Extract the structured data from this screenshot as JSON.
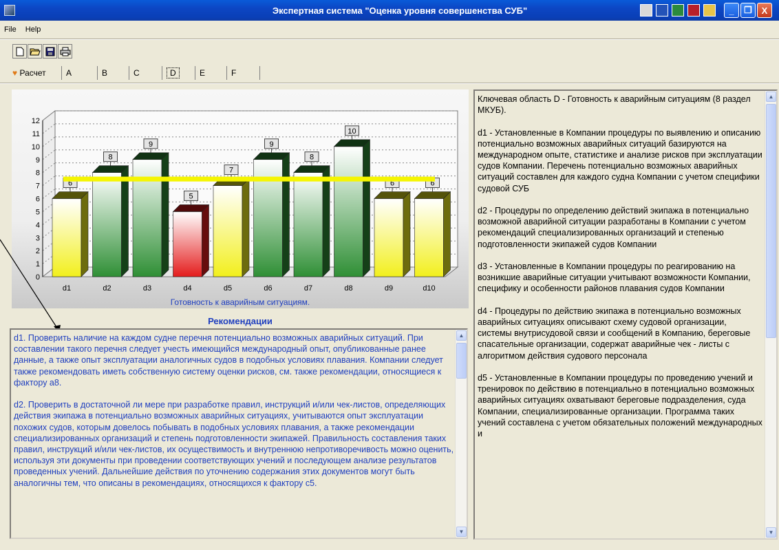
{
  "window": {
    "title": "Экспертная система \"Оценка уровня совершенства СУБ\"",
    "buttons": [
      "_",
      "❐",
      "X"
    ]
  },
  "menu": [
    "File",
    "Help"
  ],
  "toolbar_icons": [
    "new-icon",
    "open-icon",
    "save-icon",
    "print-icon"
  ],
  "tabs": [
    {
      "label": "Расчет"
    },
    {
      "label": "A"
    },
    {
      "label": "B"
    },
    {
      "label": "C"
    },
    {
      "label": "D",
      "active": true
    },
    {
      "label": "E"
    },
    {
      "label": "F"
    }
  ],
  "chart_data": {
    "type": "bar",
    "title": "Готовность к аварийным ситуациям.",
    "categories": [
      "d1",
      "d2",
      "d3",
      "d4",
      "d5",
      "d6",
      "d7",
      "d8",
      "d9",
      "d10"
    ],
    "values": [
      6,
      8,
      9,
      5,
      7,
      9,
      8,
      10,
      6,
      6
    ],
    "bar_colors": [
      "#f2ef1c",
      "#2f8f35",
      "#2f8f35",
      "#e41c1c",
      "#f2ef1c",
      "#2f8f35",
      "#2f8f35",
      "#2f8f35",
      "#f2ef1c",
      "#f2ef1c"
    ],
    "reference_line": 7.5,
    "reference_color": "#f5f500",
    "yticks": [
      0,
      1,
      2,
      3,
      4,
      5,
      6,
      7,
      8,
      9,
      10,
      11,
      12
    ],
    "ylim": [
      0,
      12
    ],
    "grid": true
  },
  "recommendations": {
    "title": "Рекомендации",
    "text": "d1. Проверить наличие на каждом судне перечня потенциально возможных аварийных ситуаций. При составлении такого перечня следует учесть имеющийся международный опыт, опубликованные ранее данные, а также опыт эксплуатации аналогичных судов в подобных условиях плавания. Компании следует также рекомендовать иметь собственную систему оценки рисков, см. также рекомендации, относящиеся к фактору а8.\n\nd2. Проверить в достаточной ли мере при разработке правил, инструкций и/или чек-листов, определяющих действия экипажа в потенциально возможных аварийных ситуациях, учитываются опыт эксплуатации похожих судов, которым довелось побывать в подобных условиях плавания, а также рекомендации специализированных организаций и степень подготовленности экипажей. Правильность составления таких правил, инструкций и/или чек-листов, их осуществимость и внутреннюю непротиворечивость можно оценить, используя эти документы при проведении соответствующих учений и последующем анализе результатов проведенных учений. Дальнейшие действия по уточнению содержания этих документов могут быть аналогичны тем, что описаны в рекомендациях, относящихся к фактору с5."
  },
  "info": {
    "text": "Ключевая область D - Готовность к аварийным ситуациям (8 раздел МКУБ).\n\nd1 - Установленные в Компании процедуры по выявлению и описанию потенциально возможных аварийных ситуаций базируются на международном опыте, статистике и анализе рисков при эксплуатации судов Компании. Перечень потенциально возможных аварийных ситуаций составлен для каждого судна Компании с учетом специфики судовой СУБ\n\nd2 - Процедуры по определению действий экипажа в потенциально возможной аварийной ситуации разработаны в Компании с учетом рекомендаций специализированных организаций и степенью подготовленности экипажей судов Компании\n\nd3 - Установленные в Компании процедуры по реагированию на возникшие аварийные ситуации учитывают возможности Компании, специфику и особенности районов плавания судов Компании\n\nd4 - Процедуры по действию экипажа в потенциально возможных аварийных ситуациях описывают схему судовой организации, системы внутрисудовой связи и сообщений в Компанию, береговые спасательные организации, содержат аварийные чек - листы с алгоритмом действия судового персонала\n\nd5 - Установленные в Компании процедуры по проведению учений и тренировок по действию в потенциально в потенциально возможных аварийных ситуациях охватывают береговые подразделения, суда Компании, специализированные организации. Программа таких учений составлена с учетом обязательных положений международных и"
  }
}
